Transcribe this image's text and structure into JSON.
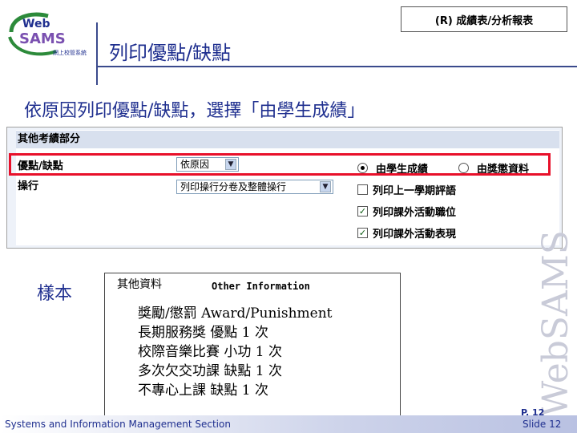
{
  "header": {
    "logo_text_web": "Web",
    "logo_text_sams": "SAMS",
    "logo_subtext": "網上校管系統",
    "section_tag": "(R) 成績表/分析報表",
    "page_title": "列印優點/缺點"
  },
  "instruction": "依原因列印優點/缺點，選擇「由學生成績」",
  "panel": {
    "header": "其他考績部分",
    "rows": [
      {
        "label": "優點/缺點",
        "select_value": "依原因"
      },
      {
        "label": "操行",
        "select_value": "列印操行分卷及整體操行"
      }
    ],
    "radio_options": [
      {
        "label": "由學生成績",
        "checked": true
      },
      {
        "label": "由獎懲資料",
        "checked": false
      }
    ],
    "checkboxes": [
      {
        "label": "列印上一學期評語",
        "checked": false
      },
      {
        "label": "列印課外活動職位",
        "checked": true
      },
      {
        "label": "列印課外活動表現",
        "checked": true
      }
    ]
  },
  "sample": {
    "label": "樣本",
    "title_zh": "其他資料",
    "title_en": "Other Information",
    "lines": [
      "獎勵/懲罰 Award/Punishment",
      "長期服務獎 優點 1 次",
      "校際音樂比賽 小功 1 次",
      "多次欠交功課 缺點 1 次",
      "不專心上課 缺點 1 次"
    ]
  },
  "watermark": "WebSAMS",
  "footer": {
    "org": "Systems and Information Management Section",
    "page": "P. 12",
    "slide": "Slide 12"
  },
  "colors": {
    "title_blue": "#1f2f8f",
    "highlight_red": "#e8102a",
    "panel_header": "#d8e0ee"
  }
}
